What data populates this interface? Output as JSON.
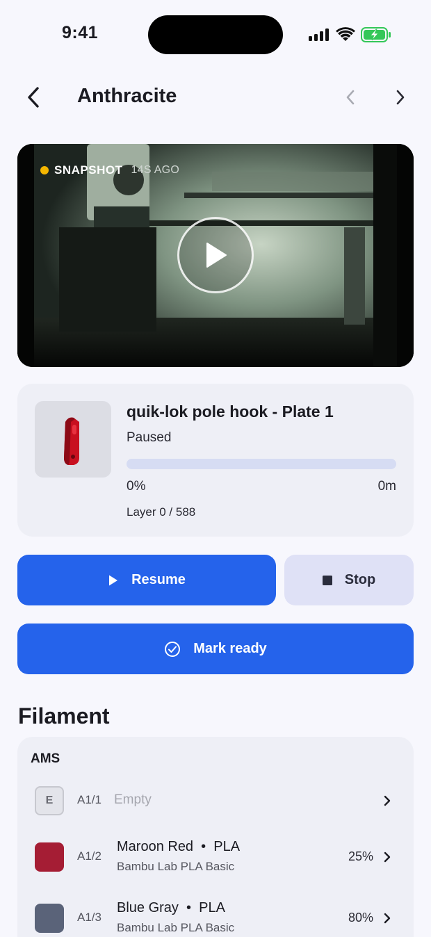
{
  "status_bar": {
    "time": "9:41"
  },
  "nav": {
    "title": "Anthracite"
  },
  "camera": {
    "status_label": "SNAPSHOT",
    "age": "14S AGO"
  },
  "job": {
    "title": "quik-lok pole hook - Plate 1",
    "state": "Paused",
    "progress_fraction": 0,
    "progress_label": "0%",
    "time_remaining": "0m",
    "layer": "Layer 0 / 588"
  },
  "actions": {
    "resume_label": "Resume",
    "stop_label": "Stop",
    "mark_ready_label": "Mark ready"
  },
  "filament": {
    "section_title": "Filament",
    "group_label": "AMS",
    "slots": [
      {
        "slot": "A1/1",
        "empty_badge": "E",
        "empty_label": "Empty"
      },
      {
        "slot": "A1/2",
        "name": "Maroon Red",
        "material": "PLA",
        "brand": "Bambu Lab PLA Basic",
        "percent": "25%",
        "color": "#a51d34"
      },
      {
        "slot": "A1/3",
        "name": "Blue Gray",
        "material": "PLA",
        "brand": "Bambu Lab PLA Basic",
        "percent": "80%",
        "color": "#5a6379"
      }
    ]
  },
  "colors": {
    "accent": "#2563eb",
    "snapshot_dot": "#f5b600",
    "part": "#c8101f"
  }
}
